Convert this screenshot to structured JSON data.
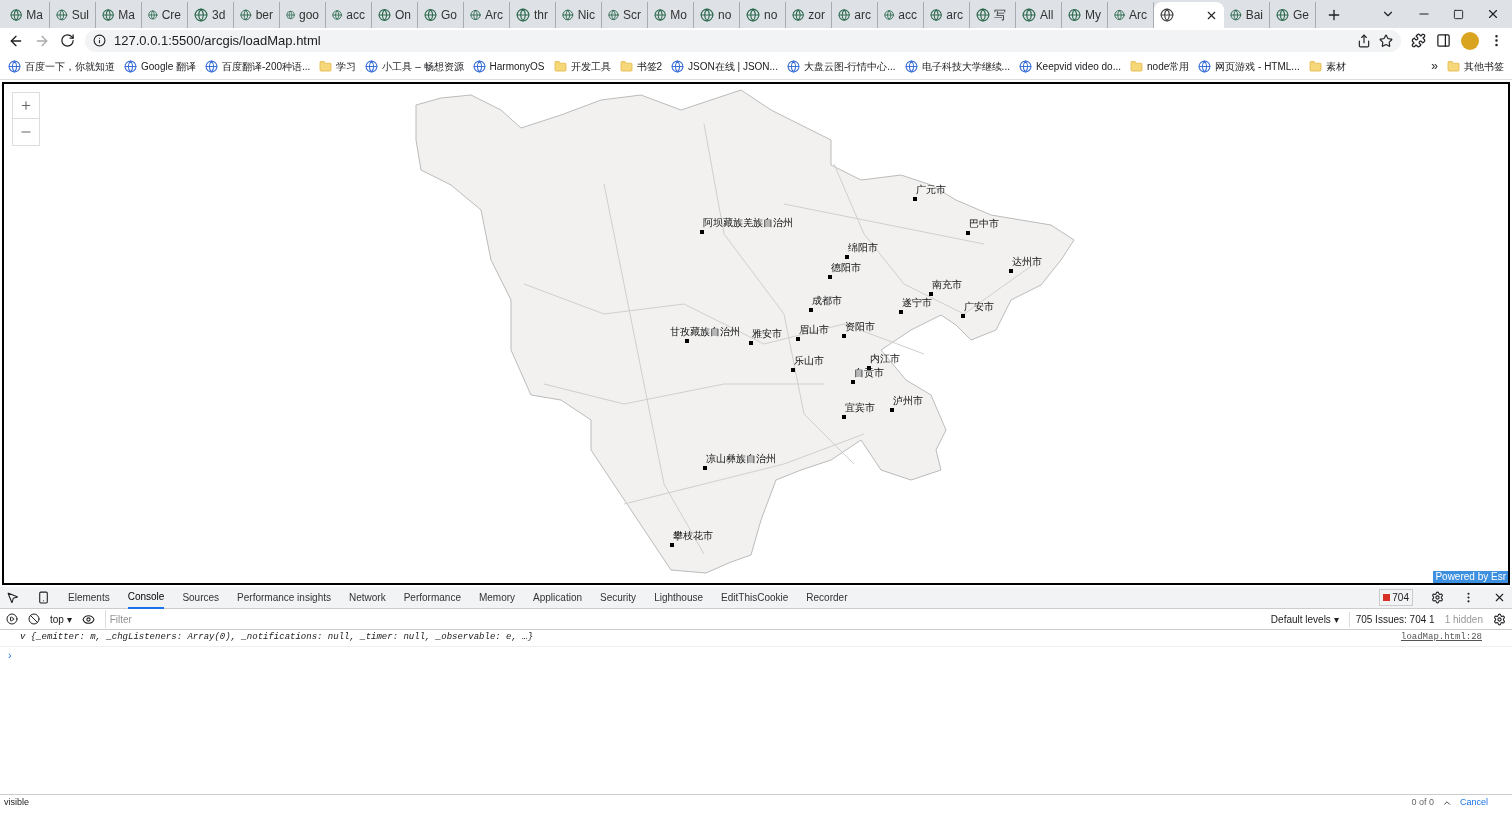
{
  "tabs": [
    {
      "label": "Ma",
      "selected": false
    },
    {
      "label": "Sul",
      "selected": false
    },
    {
      "label": "Ma",
      "selected": false
    },
    {
      "label": "Cre",
      "selected": false
    },
    {
      "label": "3d",
      "selected": false
    },
    {
      "label": "ber",
      "selected": false
    },
    {
      "label": "goo",
      "selected": false
    },
    {
      "label": "acc",
      "selected": false
    },
    {
      "label": "On",
      "selected": false
    },
    {
      "label": "Go",
      "selected": false
    },
    {
      "label": "Arc",
      "selected": false
    },
    {
      "label": "thr",
      "selected": false
    },
    {
      "label": "Nic",
      "selected": false
    },
    {
      "label": "Scr",
      "selected": false
    },
    {
      "label": "Mo",
      "selected": false
    },
    {
      "label": "no",
      "selected": false
    },
    {
      "label": "no",
      "selected": false
    },
    {
      "label": "zor",
      "selected": false
    },
    {
      "label": "arc",
      "selected": false
    },
    {
      "label": "acc",
      "selected": false
    },
    {
      "label": "arc",
      "selected": false
    },
    {
      "label": "写",
      "selected": false
    },
    {
      "label": "All",
      "selected": false
    },
    {
      "label": "My",
      "selected": false
    },
    {
      "label": "Arc",
      "selected": false
    },
    {
      "selected": true
    },
    {
      "label": "Bai",
      "selected": false
    },
    {
      "label": "Ge",
      "selected": false
    }
  ],
  "address": "127.0.0.1:5500/arcgis/loadMap.html",
  "bookmarks": [
    {
      "kind": "site",
      "label": "百度一下，你就知道"
    },
    {
      "kind": "site",
      "label": "Google 翻译"
    },
    {
      "kind": "site",
      "label": "百度翻译-200种语..."
    },
    {
      "kind": "folder",
      "label": "学习"
    },
    {
      "kind": "site",
      "label": "小工具 – 畅想资源"
    },
    {
      "kind": "site",
      "label": "HarmonyOS"
    },
    {
      "kind": "folder",
      "label": "开发工具"
    },
    {
      "kind": "folder",
      "label": "书签2"
    },
    {
      "kind": "site",
      "label": "JSON在线 | JSON..."
    },
    {
      "kind": "site",
      "label": "大盘云图-行情中心..."
    },
    {
      "kind": "site",
      "label": "电子科技大学继续..."
    },
    {
      "kind": "site",
      "label": "Keepvid video do..."
    },
    {
      "kind": "folder",
      "label": "node常用"
    },
    {
      "kind": "site",
      "label": "网页游戏 - HTML..."
    },
    {
      "kind": "folder",
      "label": "素材"
    }
  ],
  "bookmarks_more": "»",
  "other_bookmarks": "其他书签",
  "map": {
    "labels": [
      "广元市",
      "阿坝藏族羌族自治州",
      "巴中市",
      "绵阳市",
      "德阳市",
      "达州市",
      "南充市",
      "成都市",
      "遂宁市",
      "广安市",
      "甘孜藏族自治州",
      "雅安市",
      "眉山市",
      "资阳市",
      "乐山市",
      "内江市",
      "自贡市",
      "泸州市",
      "宜宾市",
      "凉山彝族自治州",
      "攀枝花市"
    ],
    "attribution": "Powered by Esr"
  },
  "devtools": {
    "tabs": [
      {
        "label": "Elements",
        "selected": false
      },
      {
        "label": "Console",
        "selected": true
      },
      {
        "label": "Sources",
        "selected": false
      },
      {
        "label": "Performance insights",
        "selected": false
      },
      {
        "label": "Network",
        "selected": false
      },
      {
        "label": "Performance",
        "selected": false
      },
      {
        "label": "Memory",
        "selected": false
      },
      {
        "label": "Application",
        "selected": false
      },
      {
        "label": "Security",
        "selected": false
      },
      {
        "label": "Lighthouse",
        "selected": false
      },
      {
        "label": "EditThisCookie",
        "selected": false
      },
      {
        "label": "Recorder",
        "selected": false
      }
    ],
    "error_count": "704",
    "context": "top",
    "dropdown_caret": "▾",
    "filter_placeholder": "Filter",
    "levels": "Default levels",
    "issues_label": "705 Issues:",
    "issues_errors": "704",
    "issues_info": "1",
    "hidden": "1 hidden",
    "message": "v {_emitter: m, _chgListeners: Array(0), _notifications: null, _timer: null, _observable: e, …}",
    "source": "loadMap.html:28",
    "prompt": "›",
    "find": {
      "value": "visible",
      "count": "0 of 0",
      "cancel": "Cancel"
    }
  }
}
